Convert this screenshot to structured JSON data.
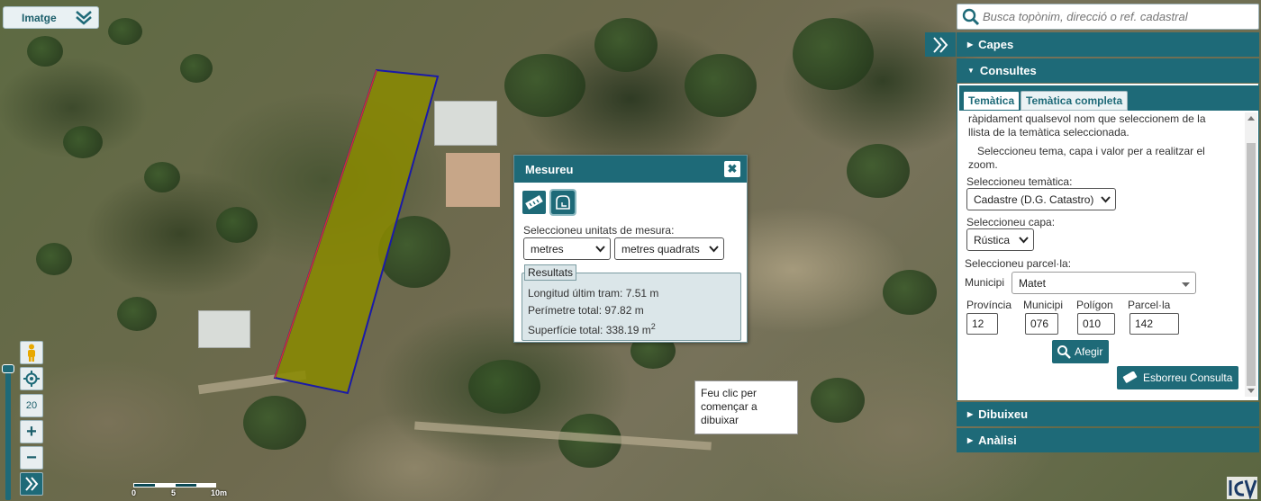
{
  "map": {
    "layer_select_label": "Imatge",
    "zoom_level": "20",
    "scale_labels": [
      "0",
      "5",
      "10m"
    ],
    "hint_text": "Feu clic per començar a dibuixar"
  },
  "measure": {
    "title": "Mesureu",
    "close_label": "✖",
    "units_label": "Seleccioneu unitats de mesura:",
    "length_unit": "metres",
    "area_unit": "metres quadrats",
    "results_label": "Resultats",
    "last_segment": "Longitud últim tram: 7.51 m",
    "total_perimeter": "Perímetre total: 97.82 m",
    "total_area": "Superfície total: 338.19 m",
    "area_superscript": "2"
  },
  "search": {
    "placeholder": "Busca topònim, direcció o ref. cadastral"
  },
  "panel": {
    "capes": "Capes",
    "consultes": "Consultes",
    "dibuixeu": "Dibuixeu",
    "analisi": "Anàlisi",
    "tabs": [
      "Temàtica",
      "Temàtica completa"
    ],
    "intro_line1": "ràpidament qualsevol nom que seleccionem de la",
    "intro_line2": "llista de la temàtica seleccionada.",
    "hint_line1": "Seleccioneu tema, capa i valor per a realitzar el",
    "hint_line2": "zoom.",
    "tematica_label": "Seleccioneu temàtica:",
    "tematica_value": "Cadastre (D.G. Catastro)",
    "capa_label": "Seleccioneu capa:",
    "capa_value": "Rústica",
    "parcela_label": "Seleccioneu parcel·la:",
    "municipi_label": "Municipi",
    "municipi_value": "Matet",
    "col_provincia": "Província",
    "col_municipi": "Municipi",
    "col_poligon": "Polígon",
    "col_parcela": "Parcel·la",
    "val_provincia": "12",
    "val_municipi": "076",
    "val_poligon": "010",
    "val_parcela": "142",
    "add_button": "Afegir",
    "clear_button": "Esborreu Consulta"
  },
  "colors": {
    "accent": "#1e6a78",
    "polygon_fill": "#8a8a00",
    "polygon_stroke": "#1a1aa8"
  }
}
